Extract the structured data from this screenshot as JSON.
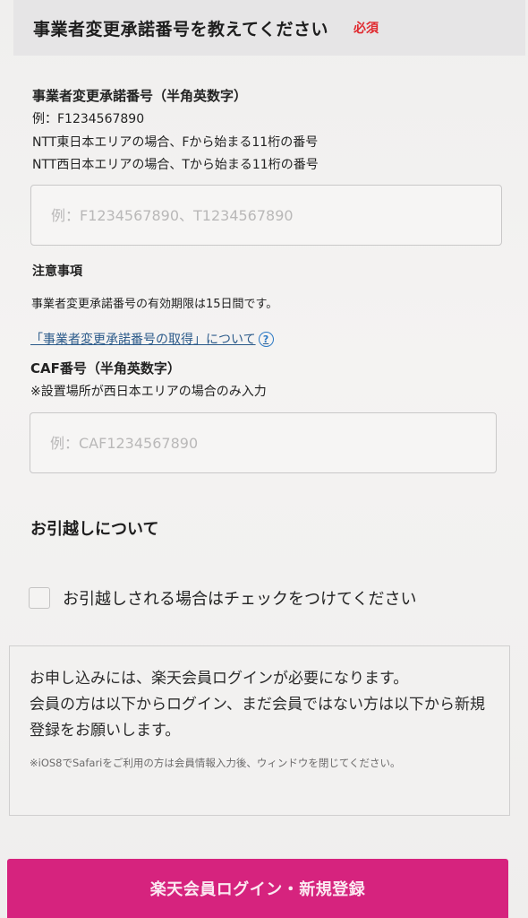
{
  "section": {
    "title": "事業者変更承諾番号を教えてください",
    "required": "必須"
  },
  "approval_number": {
    "label": "事業者変更承諾番号（半角英数字）",
    "example": "例：F1234567890",
    "east_note": "NTT東日本エリアの場合、Fから始まる11桁の番号",
    "west_note": "NTT西日本エリアの場合、Tから始まる11桁の番号",
    "value": "",
    "placeholder": "例：F1234567890、T1234567890"
  },
  "caution": {
    "title": "注意事項",
    "text": "事業者変更承諾番号の有効期限は15日間です。",
    "link_text": "「事業者変更承諾番号の取得」について",
    "help_icon": "?"
  },
  "caf": {
    "label": "CAF番号（半角英数字）",
    "note": "※設置場所が西日本エリアの場合のみ入力",
    "value": "",
    "placeholder": "例：CAF1234567890"
  },
  "moving": {
    "title": "お引越しについて",
    "checkbox_label": "お引越しされる場合はチェックをつけてください",
    "checked": false
  },
  "notice": {
    "line1": "お申し込みには、楽天会員ログインが必要になります。",
    "line2": "会員の方は以下からログイン、まだ会員ではない方は以下から新規登録をお願いします。",
    "small": "※iOS8でSafariをご利用の方は会員情報入力後、ウィンドウを閉じてください。"
  },
  "login_button": {
    "label": "楽天会員ログイン・新規登録"
  },
  "colors": {
    "required": "#e0282e",
    "link": "#2b5a8a",
    "button": "#d6237e"
  }
}
